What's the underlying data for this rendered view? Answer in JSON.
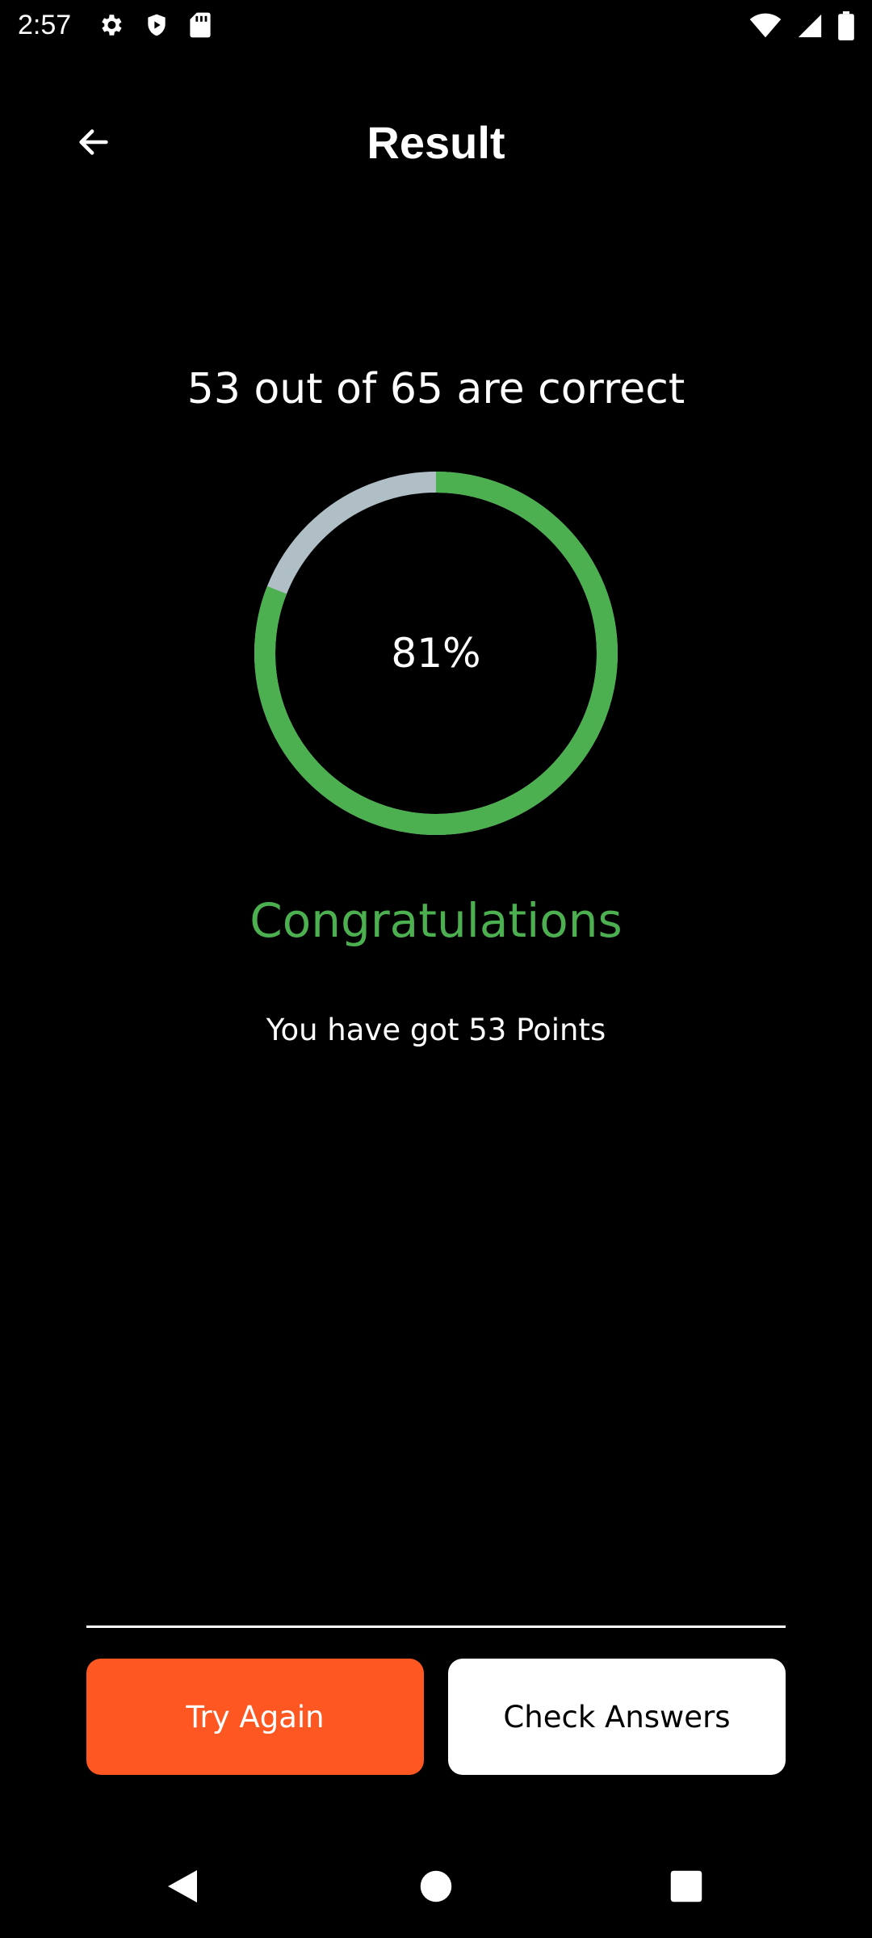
{
  "status_bar": {
    "time": "2:57",
    "left_icons": [
      "gear-icon",
      "shield-play-icon",
      "sd-card-icon"
    ],
    "right_icons": [
      "wifi-icon",
      "cellular-signal-icon",
      "battery-icon"
    ]
  },
  "header": {
    "back_icon": "arrow-left-icon",
    "title": "Result"
  },
  "result": {
    "score_text": "53 out of 65 are correct",
    "percent_text": "81%",
    "percent_value": 0.81,
    "congrats_text": "Congratulations",
    "points_text": "You have got 53 Points"
  },
  "actions": {
    "try_again_label": "Try Again",
    "check_answers_label": "Check Answers"
  },
  "nav_bar": {
    "icons": [
      "nav-back-icon",
      "nav-home-icon",
      "nav-recents-icon"
    ]
  },
  "colors": {
    "background": "#000000",
    "progress": "#4caf50",
    "track": "#b0bec5",
    "try_again": "#ff5722",
    "check_answers": "#ffffff",
    "congrats": "#4caf50"
  }
}
